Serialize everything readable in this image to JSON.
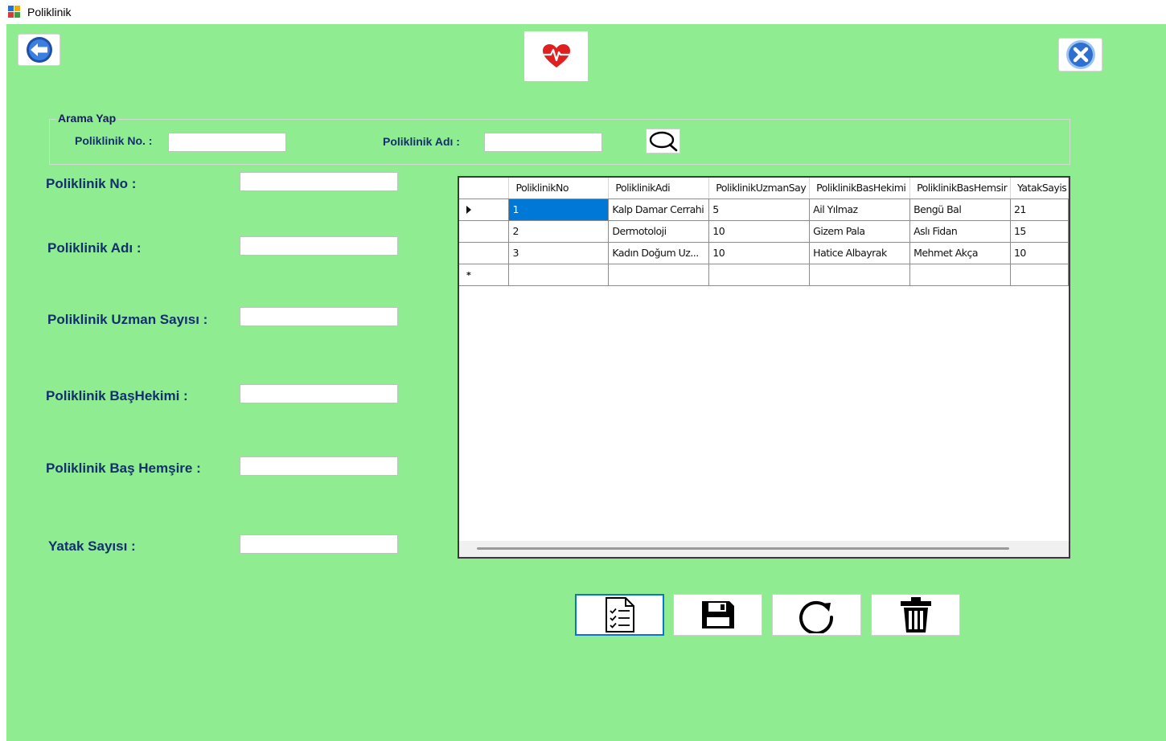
{
  "window": {
    "title": "Poliklinik"
  },
  "colors": {
    "background": "#90ec90",
    "label_text": "#12306e",
    "selection": "#0078d7"
  },
  "toolbar": {
    "back_icon": "back-arrow-icon",
    "logo_icon": "heart-pulse-icon",
    "close_icon": "close-circle-icon"
  },
  "search": {
    "group_title": "Arama Yap",
    "no_label": "Poliklinik No. :",
    "no_value": "",
    "name_label": "Poliklinik Adı :",
    "name_value": "",
    "button_icon": "search-icon"
  },
  "form": {
    "no_label": "Poliklinik No :",
    "no_value": "",
    "name_label": "Poliklinik Adı :",
    "name_value": "",
    "specialist_label": "Poliklinik Uzman Sayısı :",
    "specialist_value": "",
    "chief_doctor_label": "Poliklinik BaşHekimi :",
    "chief_doctor_value": "",
    "head_nurse_label": "Poliklinik Baş Hemşire :",
    "head_nurse_value": "",
    "beds_label": "Yatak Sayısı :",
    "beds_value": ""
  },
  "grid": {
    "columns": [
      "PoliklinikNo",
      "PoliklinikAdi",
      "PoliklinikUzmanSay",
      "PoliklinikBasHekimi",
      "PoliklinikBasHemsir",
      "YatakSayis"
    ],
    "rows": [
      [
        "1",
        "Kalp Damar Cerrahi",
        "5",
        "Ail Yılmaz",
        "Bengü Bal",
        "21"
      ],
      [
        "2",
        "Dermotoloji",
        "10",
        "Gizem Pala",
        "Aslı Fidan",
        "15"
      ],
      [
        "3",
        "Kadın Doğum Uz...",
        "10",
        "Hatice Albayrak",
        "Mehmet Akça",
        "10"
      ]
    ],
    "new_row_marker": "*"
  },
  "actions": [
    {
      "name": "list-button",
      "icon": "checklist-icon"
    },
    {
      "name": "save-button",
      "icon": "floppy-disk-icon"
    },
    {
      "name": "refresh-button",
      "icon": "refresh-icon"
    },
    {
      "name": "delete-button",
      "icon": "trash-icon"
    }
  ]
}
